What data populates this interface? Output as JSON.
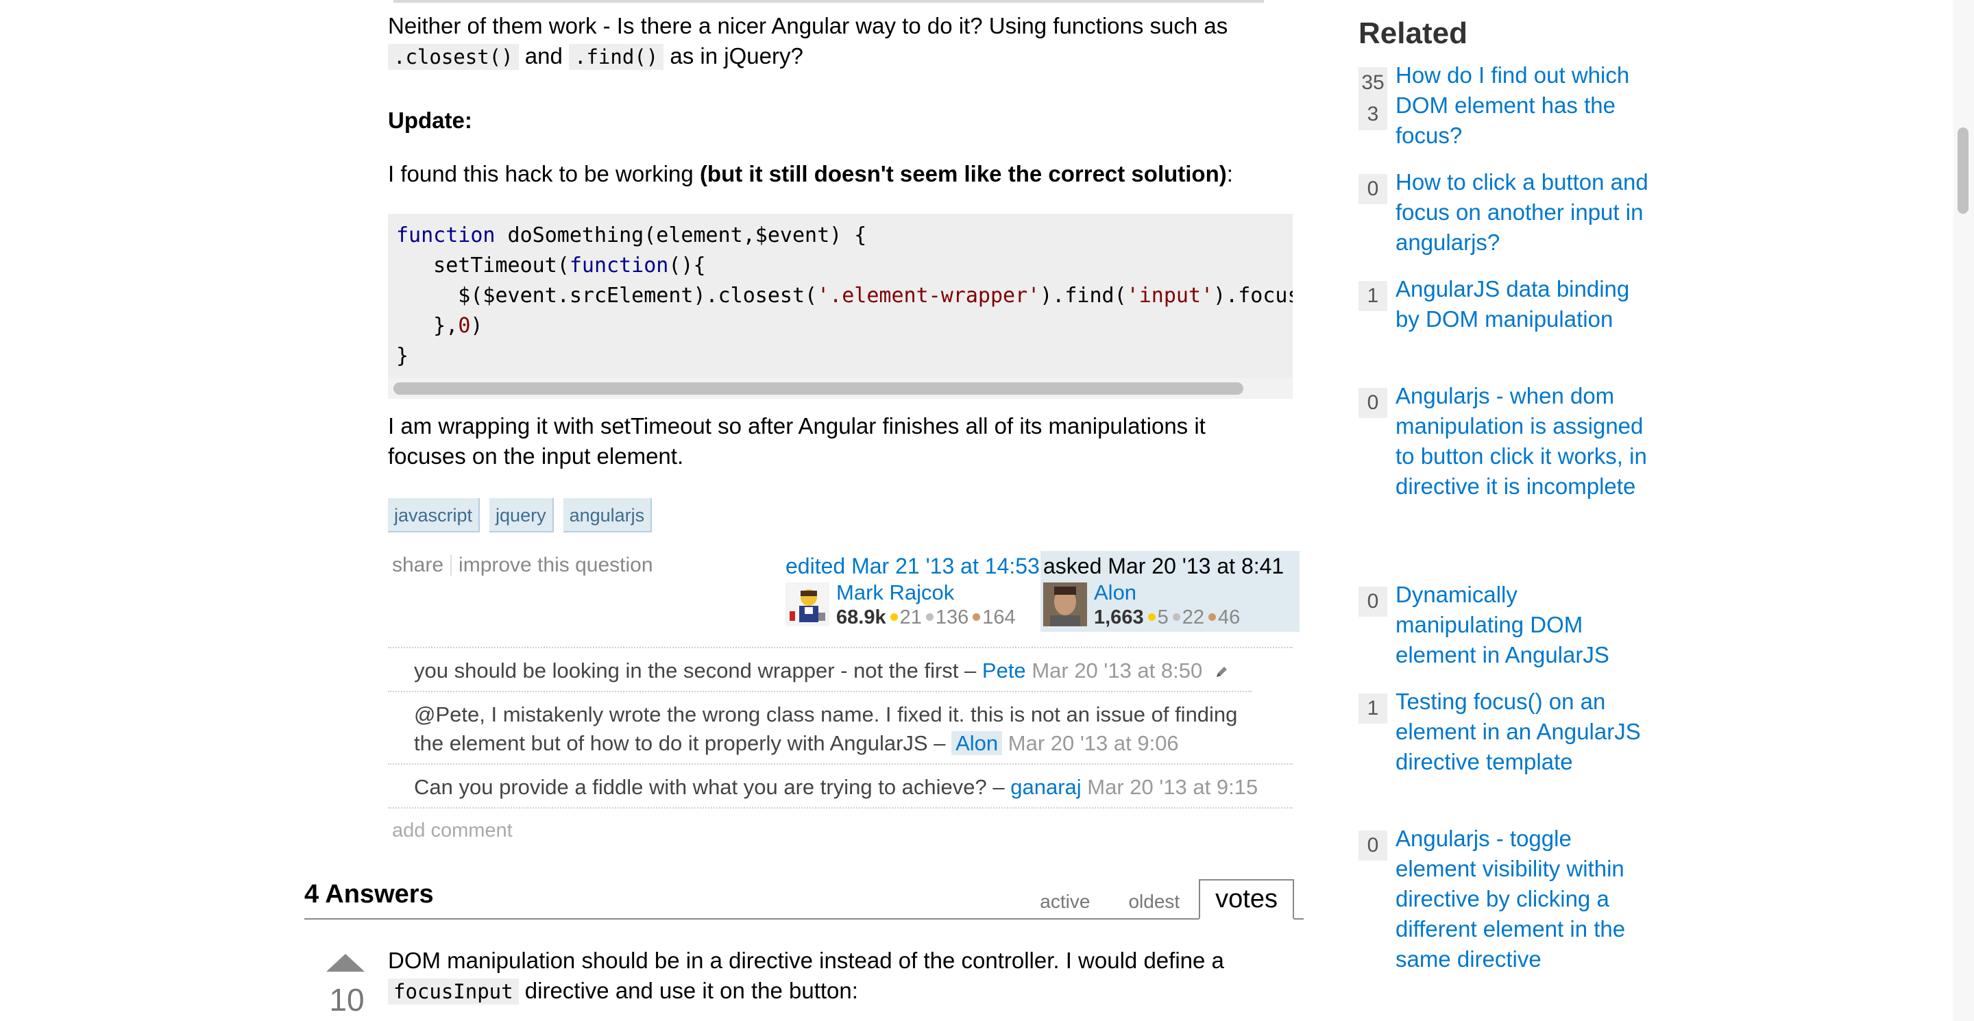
{
  "question": {
    "para1_text1": "Neither of them work - Is there a nicer Angular way to do it? Using functions such as",
    "para1_code1": ".closest()",
    "para1_and": "and",
    "para1_code2": ".find()",
    "para1_text2": "as in jQuery?",
    "update_label": "Update:",
    "para2_text": "I found this hack to be working",
    "para2_bold": "(but it still doesn't seem like the correct solution)",
    "para2_colon": ":",
    "code": {
      "l1_kw": "function",
      "l1_rest": " doSomething(element,$event) {",
      "l2_a": "   setTimeout(",
      "l2_kw": "function",
      "l2_b": "(){",
      "l3_a": "     $($event.srcElement).closest(",
      "l3_s1": "'.element-wrapper'",
      "l3_b": ").find(",
      "l3_s2": "'input'",
      "l3_c": ").focus",
      "l4_a": "   },",
      "l4_num": "0",
      "l4_b": ")",
      "l5": "}"
    },
    "para3_line1": "I am wrapping it with setTimeout so after Angular finishes all of its manipulations it",
    "para3_line2": "focuses on the input element.",
    "tags": [
      "javascript",
      "jquery",
      "angularjs"
    ],
    "menu": {
      "share": "share",
      "improve": "improve this question"
    },
    "edited": {
      "action": "edited Mar 21 '13 at 14:53",
      "name": "Mark Rajcok",
      "rep": "68.9k",
      "gold": "21",
      "silver": "136",
      "bronze": "164"
    },
    "asked": {
      "action": "asked Mar 20 '13 at 8:41",
      "name": "Alon",
      "rep": "1,663",
      "gold": "5",
      "silver": "22",
      "bronze": "46"
    }
  },
  "comments": [
    {
      "text": "you should be looking in the second wrapper - not the first –",
      "user": "Pete",
      "date": "Mar 20 '13 at 8:50"
    },
    {
      "text": "@Pete, I mistakenly wrote the wrong class name. I fixed it. this is not an issue of finding the element but of how to do it properly with AngularJS –",
      "user": "Alon",
      "date": "Mar 20 '13 at 9:06"
    },
    {
      "text": "Can you provide a fiddle with what you are trying to achieve? –",
      "user": "ganaraj",
      "date": "Mar 20 '13 at 9:15"
    }
  ],
  "add_comment": "add comment",
  "answers": {
    "title": "4 Answers",
    "tabs": [
      "active",
      "oldest",
      "votes"
    ],
    "first": {
      "votes": "10",
      "text1": "DOM manipulation should be in a directive instead of the controller. I would define a",
      "code": "focusInput",
      "text2": "directive and use it on the button:"
    }
  },
  "sidebar": {
    "title": "Related",
    "items": [
      {
        "score": "35\n3",
        "title": "How do I find out which DOM element has the focus?"
      },
      {
        "score": "0",
        "title": "How to click a button and focus on another input in angularjs?"
      },
      {
        "score": "1",
        "title": "AngularJS data binding by DOM manipulation"
      },
      {
        "score": "0",
        "title": "Angularjs - when dom manipulation is assigned to button click it works, in directive it is incomplete"
      },
      {
        "score": "0",
        "title": "Dynamically manipulating DOM element in AngularJS"
      },
      {
        "score": "1",
        "title": "Testing focus() on an element in an AngularJS directive template"
      },
      {
        "score": "0",
        "title": "Angularjs - toggle element visibility within directive by clicking a different element in the same directive"
      }
    ]
  },
  "colors": {
    "link": "#0077cc",
    "tag_bg": "#e0eaf1",
    "code_bg": "#eeeeee"
  }
}
